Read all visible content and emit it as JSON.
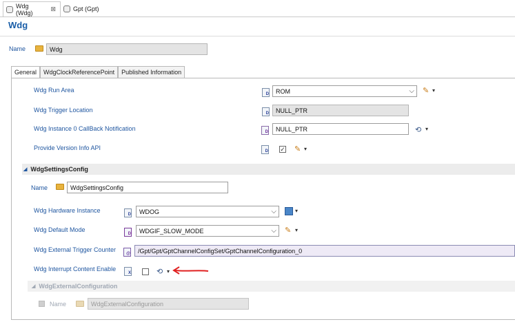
{
  "editor_tabs": [
    {
      "label": "Wdg (Wdg)",
      "close": "⊠"
    },
    {
      "label": "Gpt (Gpt)"
    }
  ],
  "page_title": "Wdg",
  "name": {
    "label": "Name",
    "value": "Wdg"
  },
  "tabs": [
    "General",
    "WdgClockReferencePoint",
    "Published Information"
  ],
  "general": {
    "run_area": {
      "label": "Wdg Run Area",
      "value": "ROM"
    },
    "trigger_location": {
      "label": "Wdg Trigger Location",
      "value": "NULL_PTR"
    },
    "callback": {
      "label": "Wdg Instance 0 CallBack Notification",
      "value": "NULL_PTR"
    },
    "version_info": {
      "label": "Provide Version Info API",
      "checked": true
    }
  },
  "settings": {
    "header": "WdgSettingsConfig",
    "name_label": "Name",
    "name_value": "WdgSettingsConfig",
    "hw_instance": {
      "label": "Wdg Hardware Instance",
      "value": "WDOG"
    },
    "default_mode": {
      "label": "Wdg Default Mode",
      "value": "WDGIF_SLOW_MODE"
    },
    "ext_trigger": {
      "label": "Wdg External Trigger Counter",
      "value": "/Gpt/Gpt/GptChannelConfigSet/GptChannelConfiguration_0"
    },
    "interrupt": {
      "label": "Wdg Interrupt Content Enable",
      "checked": false
    }
  },
  "external_config": {
    "header": "WdgExternalConfiguration",
    "name_label": "Name",
    "name_value": "WdgExternalConfiguration"
  },
  "glyphs": {
    "dropdown": "⌵",
    "caret": "▾",
    "collapse": "◢",
    "check": "✓"
  },
  "colors": {
    "label": "#1f56a0",
    "title": "#1a5ea8",
    "annotation_arrow": "#e02020"
  }
}
